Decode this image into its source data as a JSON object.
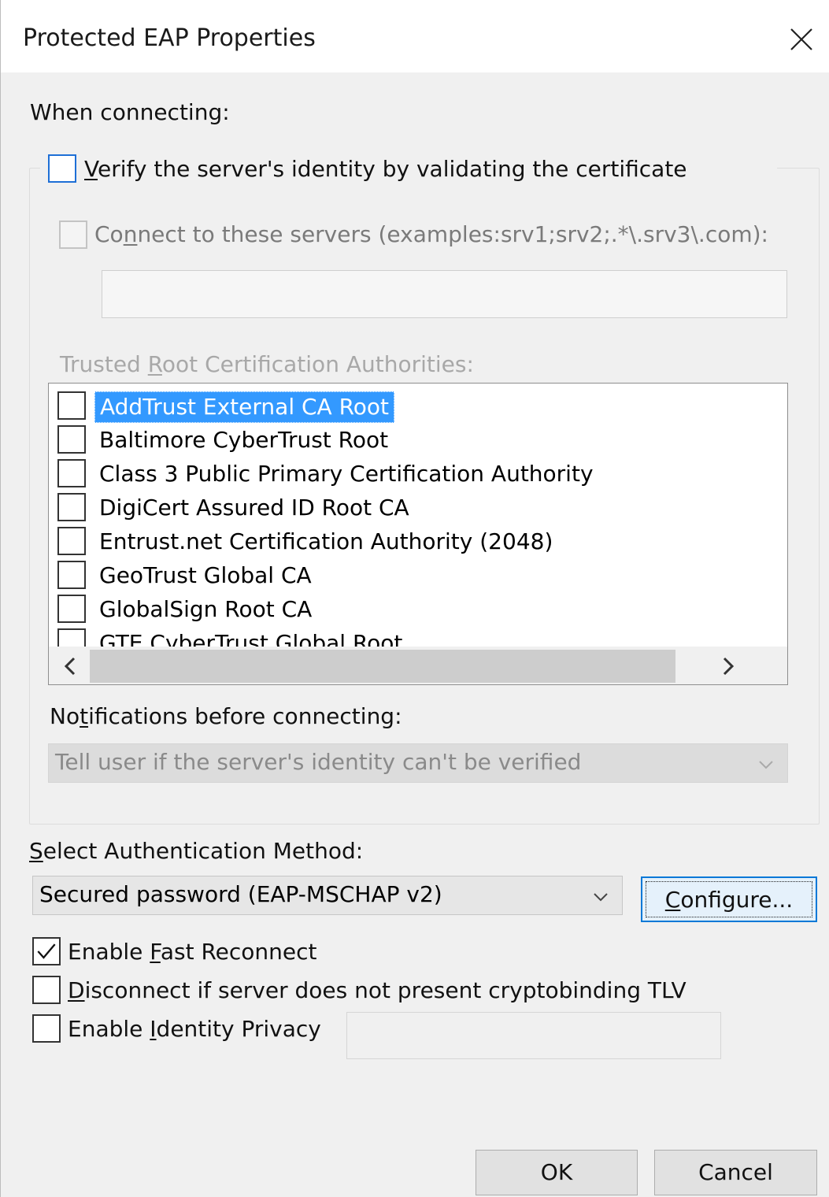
{
  "window": {
    "title": "Protected EAP Properties"
  },
  "when_connecting_label": "When connecting:",
  "verify_identity": {
    "label": "Verify the server's identity by validating the certificate",
    "checked": false
  },
  "connect_servers": {
    "label": "Connect to these servers (examples:srv1;srv2;.*\\.srv3\\.com):",
    "checked": false,
    "value": ""
  },
  "trusted_roots": {
    "label": "Trusted Root Certification Authorities:",
    "items": [
      {
        "label": "AddTrust External CA Root",
        "checked": false,
        "selected": true
      },
      {
        "label": "Baltimore CyberTrust Root",
        "checked": false
      },
      {
        "label": "Class 3 Public Primary Certification Authority",
        "checked": false
      },
      {
        "label": "DigiCert Assured ID Root CA",
        "checked": false
      },
      {
        "label": "Entrust.net Certification Authority (2048)",
        "checked": false
      },
      {
        "label": "GeoTrust Global CA",
        "checked": false
      },
      {
        "label": "GlobalSign Root CA",
        "checked": false
      },
      {
        "label": "GTE CyberTrust Global Root",
        "checked": false
      }
    ]
  },
  "notifications": {
    "label": "Notifications before connecting:",
    "selected": "Tell user if the server's identity can't be verified"
  },
  "auth_method": {
    "label": "Select Authentication Method:",
    "selected": "Secured password (EAP-MSCHAP v2)",
    "configure_label": "Configure..."
  },
  "options": {
    "fast_reconnect": {
      "label": "Enable Fast Reconnect",
      "checked": true
    },
    "disconnect_tlv": {
      "label": "Disconnect if server does not present cryptobinding TLV",
      "checked": false
    },
    "identity_privacy": {
      "label": "Enable Identity Privacy",
      "checked": false,
      "value": ""
    }
  },
  "buttons": {
    "ok": "OK",
    "cancel": "Cancel"
  },
  "colors": {
    "selection": "#3399ff",
    "focus": "#0078d7",
    "dialog_bg": "#f0f0f0"
  }
}
